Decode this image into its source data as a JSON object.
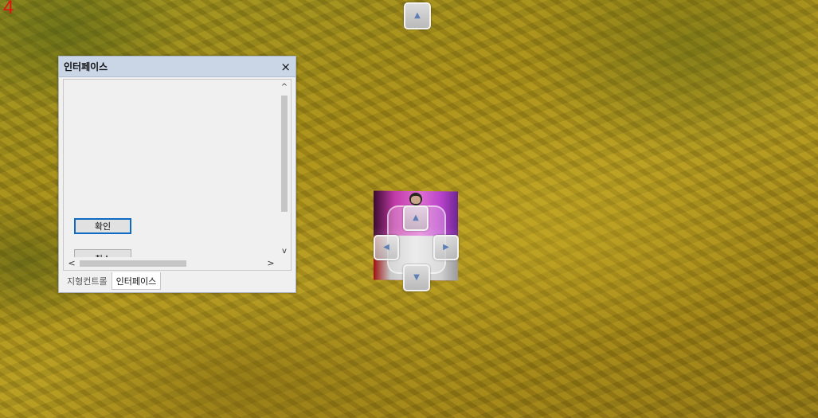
{
  "hud": {
    "frame_counter": "4"
  },
  "window": {
    "title": "인터페이스",
    "close_glyph": "×",
    "buttons": {
      "ok_label": "확인",
      "cancel_label": "취소"
    },
    "tabs": [
      {
        "label": "지형컨트롤",
        "active": false
      },
      {
        "label": "인터페이스",
        "active": true
      }
    ]
  },
  "icons": {
    "up": "▲",
    "down": "▼",
    "left": "◀",
    "right": "▶",
    "scroll_up": "^",
    "scroll_down": "v",
    "scroll_left": "<",
    "scroll_right": ">"
  },
  "colors": {
    "frame_counter": "#e31212",
    "arrow_glyph": "#5e7fb6",
    "ok_button_border": "#0f6ac4",
    "titlebar": "#cad6e6"
  }
}
